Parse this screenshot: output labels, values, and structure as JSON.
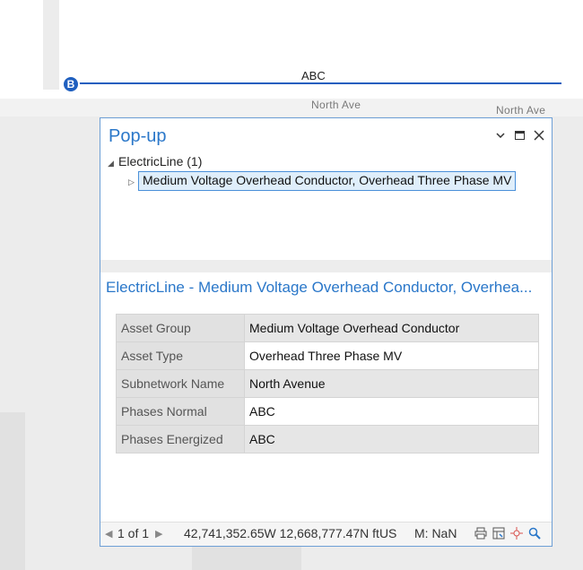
{
  "map": {
    "line_label": "ABC",
    "node_label": "B",
    "road_label_1": "North Ave",
    "road_label_2": "North Ave",
    "line_color": "#1f5fbf"
  },
  "popup": {
    "title": "Pop-up",
    "controls": {
      "options_icon": "chevron-down-icon",
      "maximize_icon": "maximize-icon",
      "close_icon": "close-icon"
    },
    "tree": {
      "layer": "ElectricLine (1)",
      "feature": "Medium Voltage Overhead Conductor, Overhead Three Phase MV"
    },
    "feature_title": "ElectricLine - Medium Voltage Overhead Conductor, Overhea...",
    "attributes": [
      {
        "key": "Asset Group",
        "value": "Medium Voltage Overhead Conductor"
      },
      {
        "key": "Asset Type",
        "value": "Overhead Three Phase MV"
      },
      {
        "key": "Subnetwork Name",
        "value": "North Avenue"
      },
      {
        "key": "Phases Normal",
        "value": "ABC"
      },
      {
        "key": "Phases Energized",
        "value": "ABC"
      }
    ],
    "status": {
      "page": "1 of 1",
      "coords": "42,741,352.65W 12,668,777.47N ftUS",
      "m_value": "M: NaN"
    },
    "accent_color": "#2a77c9"
  }
}
